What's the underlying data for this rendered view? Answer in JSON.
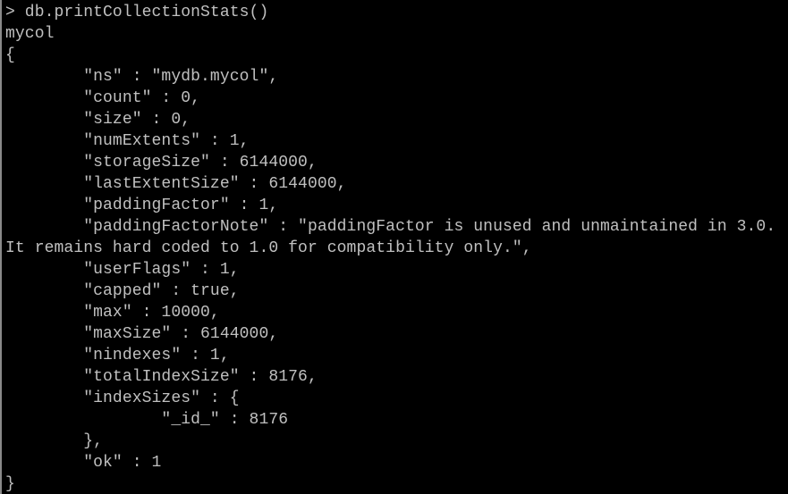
{
  "terminal": {
    "lines": [
      "> db.printCollectionStats()",
      "mycol",
      "{",
      "        \"ns\" : \"mydb.mycol\",",
      "        \"count\" : 0,",
      "        \"size\" : 0,",
      "        \"numExtents\" : 1,",
      "        \"storageSize\" : 6144000,",
      "        \"lastExtentSize\" : 6144000,",
      "        \"paddingFactor\" : 1,",
      "        \"paddingFactorNote\" : \"paddingFactor is unused and unmaintained in 3.0.",
      "It remains hard coded to 1.0 for compatibility only.\",",
      "        \"userFlags\" : 1,",
      "        \"capped\" : true,",
      "        \"max\" : 10000,",
      "        \"maxSize\" : 6144000,",
      "        \"nindexes\" : 1,",
      "        \"totalIndexSize\" : 8176,",
      "        \"indexSizes\" : {",
      "                \"_id_\" : 8176",
      "        },",
      "        \"ok\" : 1",
      "}"
    ]
  },
  "colors": {
    "background": "#000000",
    "text": "#c0c0c0"
  }
}
